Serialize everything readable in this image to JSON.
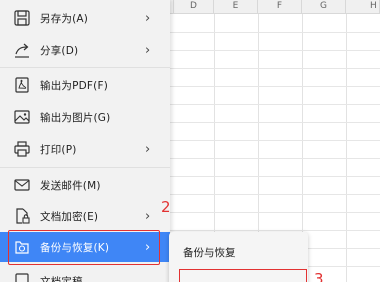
{
  "spreadsheet": {
    "columns": [
      "D",
      "E",
      "F",
      "G",
      "H"
    ]
  },
  "menu": {
    "items": [
      {
        "label": "另存为(A)",
        "icon": "save-as-icon",
        "has_submenu": true
      },
      {
        "label": "分享(D)",
        "icon": "share-icon",
        "has_submenu": true
      },
      {
        "label": "输出为PDF(F)",
        "icon": "pdf-icon",
        "has_submenu": false
      },
      {
        "label": "输出为图片(G)",
        "icon": "image-icon",
        "has_submenu": false
      },
      {
        "label": "打印(P)",
        "icon": "printer-icon",
        "has_submenu": true
      },
      {
        "label": "发送邮件(M)",
        "icon": "mail-icon",
        "has_submenu": false
      },
      {
        "label": "文档加密(E)",
        "icon": "lock-document-icon",
        "has_submenu": true
      },
      {
        "label": "备份与恢复(K)",
        "icon": "backup-icon",
        "has_submenu": true,
        "active": true
      },
      {
        "label": "文档定稿",
        "icon": "finalize-icon",
        "has_submenu": false
      }
    ],
    "chevron": "›"
  },
  "submenu": {
    "title": "备份与恢复"
  },
  "annotations": {
    "step2": "2",
    "step3": "3",
    "color": "#e23232"
  },
  "colors": {
    "accent": "#3f86f6",
    "menu_bg": "#f2f2f2"
  }
}
